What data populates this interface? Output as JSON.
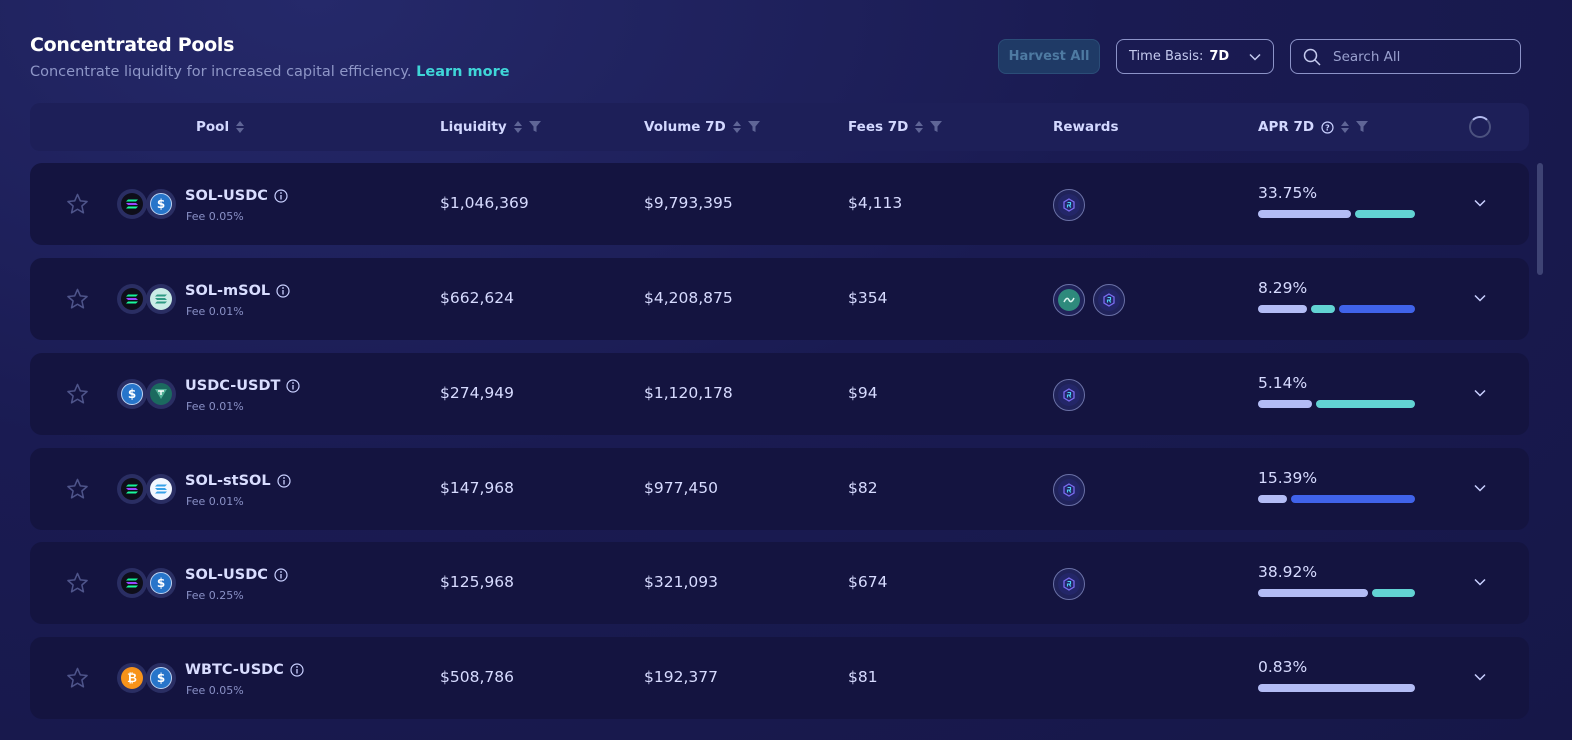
{
  "header": {
    "title": "Concentrated Pools",
    "subtitle": "Concentrate liquidity for increased capital efficiency.",
    "learn_more": "Learn more"
  },
  "toolbar": {
    "harvest_label": "Harvest All",
    "time_basis_label": "Time Basis:",
    "time_basis_value": "7D",
    "search_placeholder": "Search All"
  },
  "columns": {
    "pool": "Pool",
    "liquidity": "Liquidity",
    "volume": "Volume 7D",
    "fees": "Fees 7D",
    "rewards": "Rewards",
    "apr": "APR 7D"
  },
  "rows": [
    {
      "name": "SOL-USDC",
      "fee": "Fee 0.05%",
      "liquidity": "$1,046,369",
      "volume": "$9,793,395",
      "fees": "$4,113",
      "tokens": [
        "sol-icon",
        "usdc-icon"
      ],
      "rewards": [
        "ray-icon"
      ],
      "apr": "33.75%",
      "apr_split": [
        {
          "type": "fees",
          "color": "#b3bcf5",
          "fraction": 0.61
        },
        {
          "type": "reward",
          "color": "#62d3d3",
          "fraction": 0.39
        }
      ]
    },
    {
      "name": "SOL-mSOL",
      "fee": "Fee 0.01%",
      "liquidity": "$662,624",
      "volume": "$4,208,875",
      "fees": "$354",
      "tokens": [
        "sol-icon",
        "msol-icon"
      ],
      "rewards": [
        "mnde-icon",
        "ray-icon"
      ],
      "apr": "8.29%",
      "apr_split": [
        {
          "type": "fees",
          "color": "#b3bcf5",
          "fraction": 0.33
        },
        {
          "type": "reward",
          "color": "#62d3d3",
          "fraction": 0.16
        },
        {
          "type": "reward",
          "color": "#4063ea",
          "fraction": 0.51
        }
      ]
    },
    {
      "name": "USDC-USDT",
      "fee": "Fee 0.01%",
      "liquidity": "$274,949",
      "volume": "$1,120,178",
      "fees": "$94",
      "tokens": [
        "usdc-icon",
        "usdt-icon"
      ],
      "rewards": [
        "ray-icon"
      ],
      "apr": "5.14%",
      "apr_split": [
        {
          "type": "fees",
          "color": "#b3bcf5",
          "fraction": 0.35
        },
        {
          "type": "reward",
          "color": "#62d3d3",
          "fraction": 0.65
        }
      ]
    },
    {
      "name": "SOL-stSOL",
      "fee": "Fee 0.01%",
      "liquidity": "$147,968",
      "volume": "$977,450",
      "fees": "$82",
      "tokens": [
        "sol-icon",
        "stsol-icon"
      ],
      "rewards": [
        "ray-icon"
      ],
      "apr": "15.39%",
      "apr_split": [
        {
          "type": "fees",
          "color": "#b3bcf5",
          "fraction": 0.19
        },
        {
          "type": "reward",
          "color": "#4063ea",
          "fraction": 0.81
        }
      ]
    },
    {
      "name": "SOL-USDC",
      "fee": "Fee 0.25%",
      "liquidity": "$125,968",
      "volume": "$321,093",
      "fees": "$674",
      "tokens": [
        "sol-icon",
        "usdc-icon"
      ],
      "rewards": [
        "ray-icon"
      ],
      "apr": "38.92%",
      "apr_split": [
        {
          "type": "fees",
          "color": "#b3bcf5",
          "fraction": 0.72
        },
        {
          "type": "reward",
          "color": "#62d3d3",
          "fraction": 0.28
        }
      ]
    },
    {
      "name": "WBTC-USDC",
      "fee": "Fee 0.05%",
      "liquidity": "$508,786",
      "volume": "$192,377",
      "fees": "$81",
      "tokens": [
        "btc-icon",
        "usdc-icon"
      ],
      "rewards": [],
      "apr": "0.83%",
      "apr_split": [
        {
          "type": "fees",
          "color": "#b3bcf5",
          "fraction": 1.0
        }
      ]
    }
  ]
}
